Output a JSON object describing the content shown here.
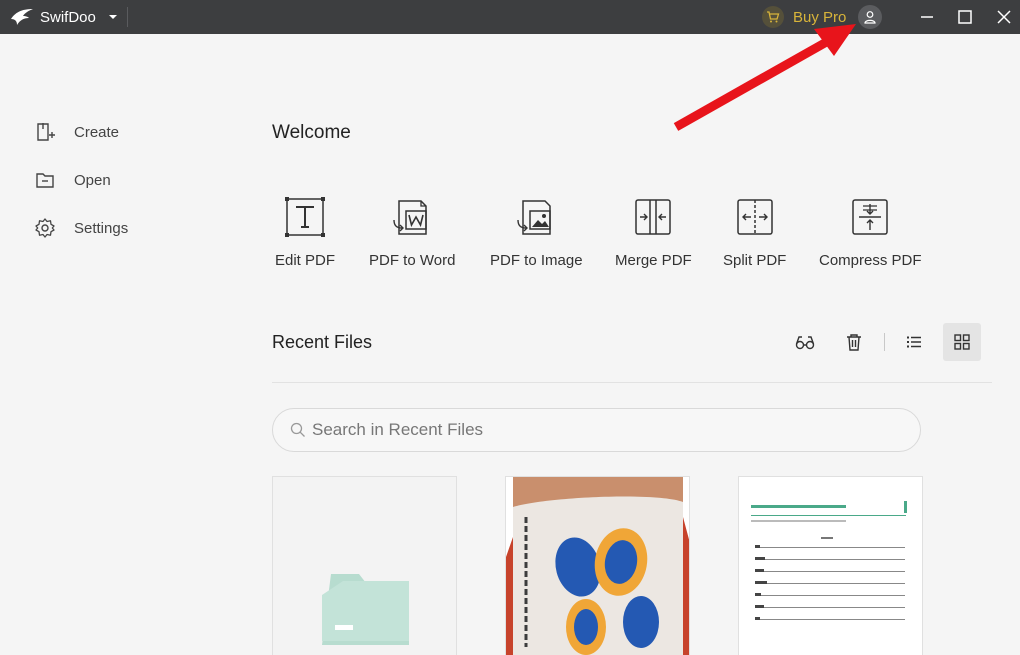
{
  "app": {
    "name": "SwifDoo"
  },
  "titlebar": {
    "buy_pro": "Buy Pro"
  },
  "sidebar": {
    "items": [
      {
        "label": "Create",
        "icon": "create-file-icon"
      },
      {
        "label": "Open",
        "icon": "folder-open-icon"
      },
      {
        "label": "Settings",
        "icon": "gear-icon"
      }
    ]
  },
  "main": {
    "welcome": "Welcome",
    "tools": [
      {
        "label": "Edit PDF",
        "icon": "text-edit-icon"
      },
      {
        "label": "PDF to Word",
        "icon": "word-doc-icon"
      },
      {
        "label": "PDF to Image",
        "icon": "image-icon"
      },
      {
        "label": "Merge PDF",
        "icon": "merge-icon"
      },
      {
        "label": "Split PDF",
        "icon": "split-icon"
      },
      {
        "label": "Compress PDF",
        "icon": "compress-icon"
      }
    ],
    "recent": {
      "title": "Recent Files",
      "search_placeholder": "Search in Recent Files",
      "view_mode": "grid"
    }
  },
  "colors": {
    "titlebar_bg": "#3d3e40",
    "accent_gold": "#d8b43a",
    "folder_green": "#b7dccf",
    "annotation_arrow": "#e8141b"
  }
}
